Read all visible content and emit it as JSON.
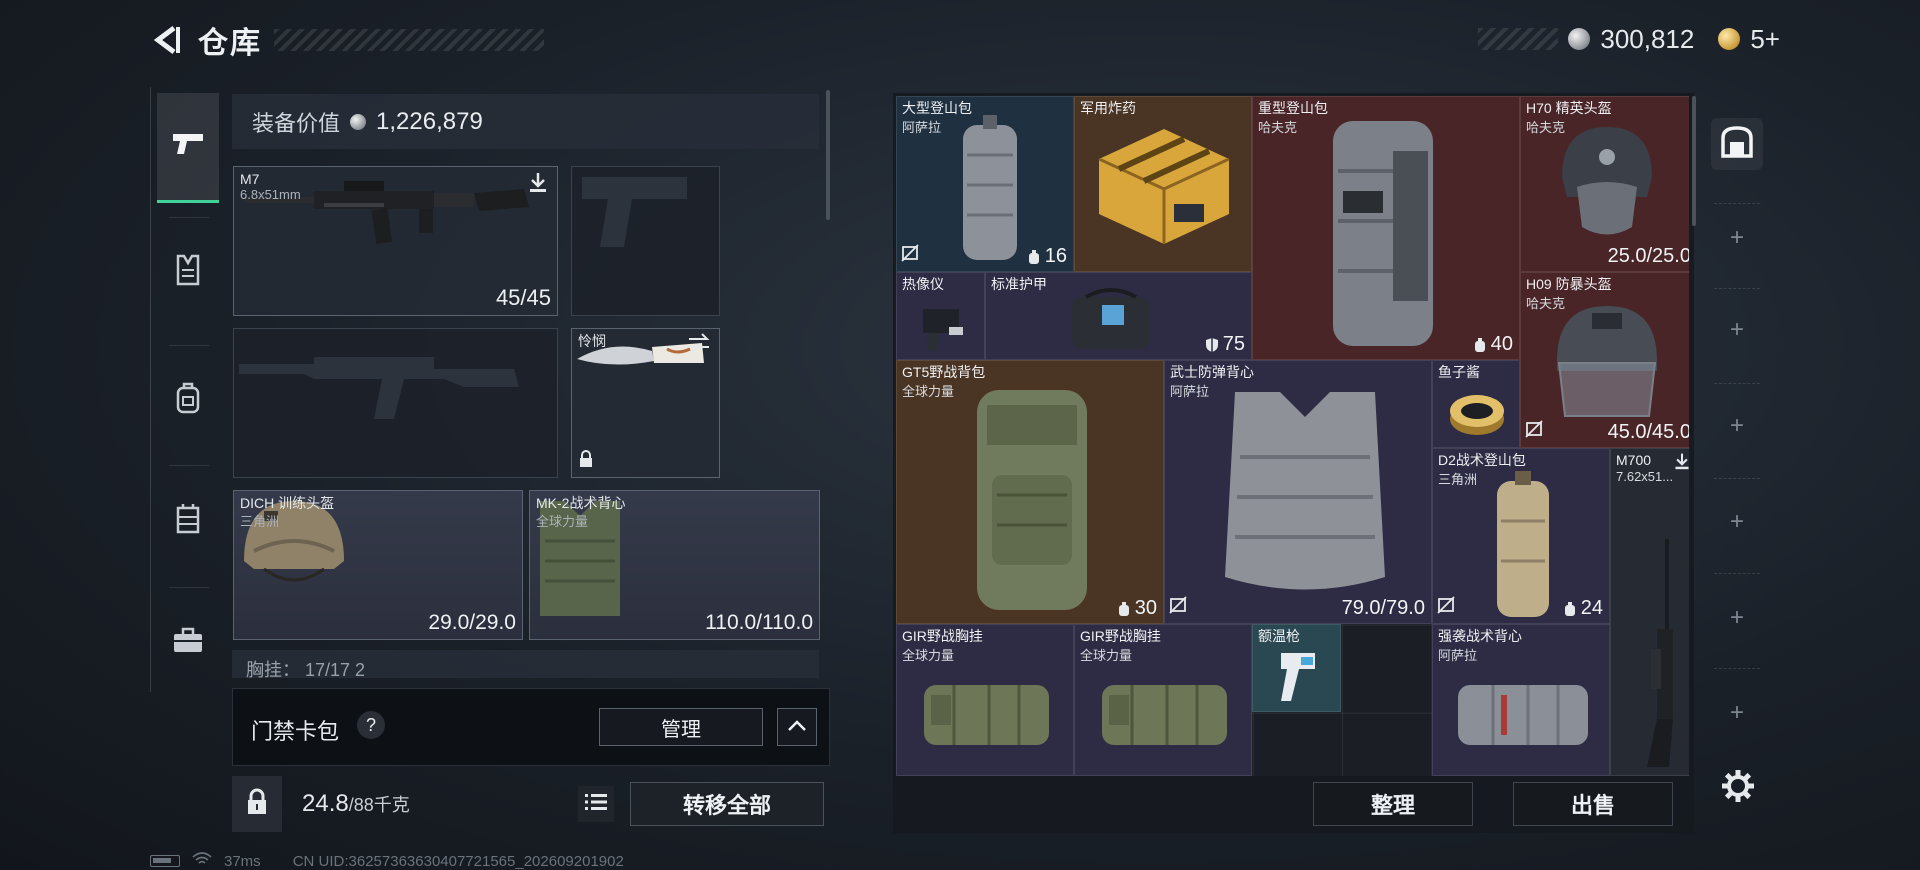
{
  "header": {
    "title": "仓库",
    "currency": [
      {
        "type": "silver",
        "value": "300,812"
      },
      {
        "type": "gold",
        "value": "5+"
      }
    ]
  },
  "left_tabs": [
    {
      "name": "weapon-tab",
      "icon": "pistol-icon",
      "active": true
    },
    {
      "name": "armor-tab",
      "icon": "vest-icon",
      "active": false
    },
    {
      "name": "backpack-tab",
      "icon": "backpack-icon",
      "active": false
    },
    {
      "name": "rig-tab",
      "icon": "rig-icon",
      "active": false
    },
    {
      "name": "case-tab",
      "icon": "briefcase-icon",
      "active": false
    }
  ],
  "loadout": {
    "equip_value_label": "装备价值",
    "equip_value": "1,226,879",
    "primary": {
      "name": "M7",
      "ammo": "6.8x51mm",
      "count": "45/45"
    },
    "melee": {
      "name": "怜悯"
    },
    "helmet": {
      "name": "DICH 训练头盔",
      "maker": "三角洲",
      "durability": "29.0/29.0"
    },
    "armor": {
      "name": "MK-2战术背心",
      "maker": "全球力量",
      "durability": "110.0/110.0"
    },
    "rig_partial": "胸挂： 17/17  2"
  },
  "keycard": {
    "label": "门禁卡包",
    "help": "?",
    "manage": "管理"
  },
  "bottom_left": {
    "weight": "24.8",
    "weight_max": "/88千克",
    "transfer_all": "转移全部"
  },
  "status": {
    "ping": "37ms",
    "uid": "CN UID:36257363630407721565_202609201902"
  },
  "storage": {
    "items": [
      {
        "id": "large-mountain-backpack",
        "name": "大型登山包",
        "maker": "阿萨拉",
        "value": "16"
      },
      {
        "id": "military-explosive",
        "name": "军用炸药",
        "maker": ""
      },
      {
        "id": "heavy-mountain-backpack",
        "name": "重型登山包",
        "maker": "哈夫克",
        "value": "40"
      },
      {
        "id": "h70-helmet",
        "name": "H70 精英头盔",
        "maker": "哈夫克",
        "value": "25.0/25.0"
      },
      {
        "id": "thermal-imager",
        "name": "热像仪",
        "maker": ""
      },
      {
        "id": "standard-armor",
        "name": "标准护甲",
        "maker": "",
        "value": "75"
      },
      {
        "id": "h09-helmet",
        "name": "H09 防暴头盔",
        "maker": "哈夫克",
        "value": "45.0/45.0"
      },
      {
        "id": "gt5-backpack",
        "name": "GT5野战背包",
        "maker": "全球力量",
        "value": "30"
      },
      {
        "id": "samurai-vest",
        "name": "武士防弹背心",
        "maker": "阿萨拉",
        "value": "79.0/79.0"
      },
      {
        "id": "caviar",
        "name": "鱼子酱",
        "maker": ""
      },
      {
        "id": "d2-backpack",
        "name": "D2战术登山包",
        "maker": "三角洲",
        "value": "24"
      },
      {
        "id": "m700-rifle",
        "name": "M700",
        "maker": "7.62x51..."
      },
      {
        "id": "gir-rig-1",
        "name": "GIR野战胸挂",
        "maker": "全球力量"
      },
      {
        "id": "gir-rig-2",
        "name": "GIR野战胸挂",
        "maker": "全球力量"
      },
      {
        "id": "thermometer-gun",
        "name": "额温枪",
        "maker": ""
      },
      {
        "id": "assault-vest",
        "name": "强袭战术背心",
        "maker": "阿萨拉"
      }
    ],
    "sort": "整理",
    "sell": "出售"
  }
}
